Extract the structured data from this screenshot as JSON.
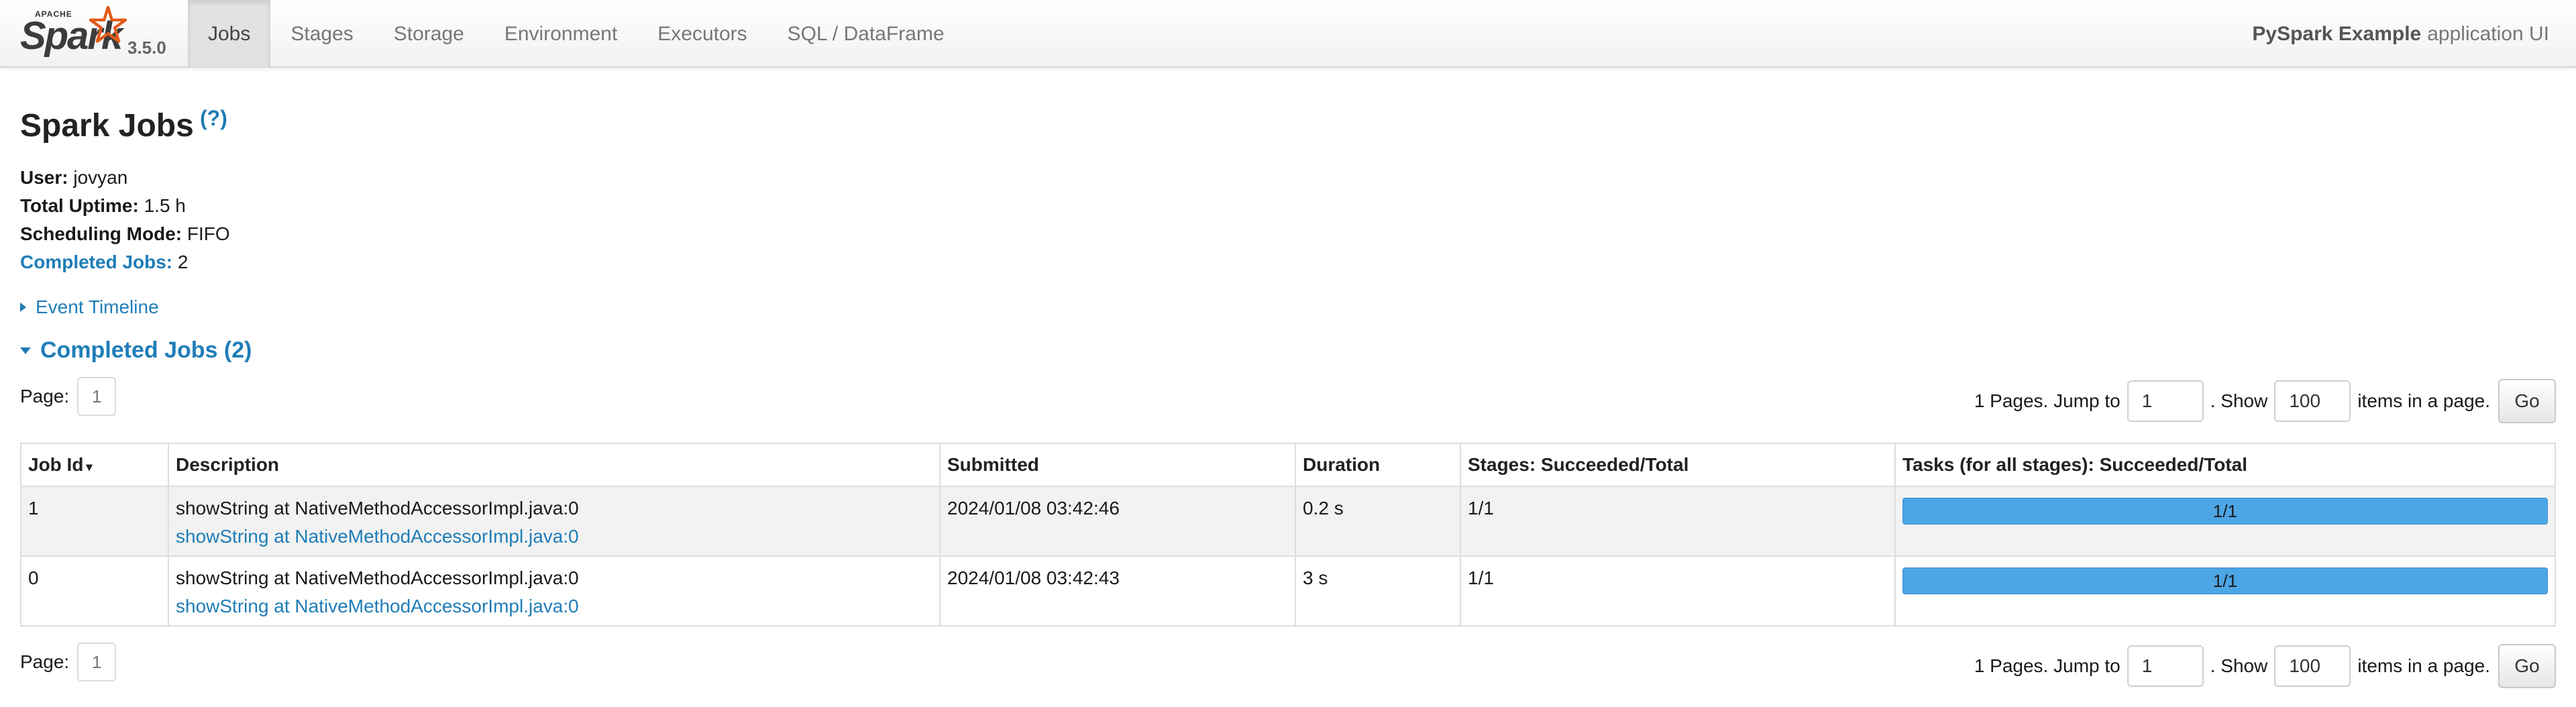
{
  "brand": {
    "apache": "APACHE",
    "name": "Spark",
    "version": "3.5.0"
  },
  "nav": {
    "items": [
      "Jobs",
      "Stages",
      "Storage",
      "Environment",
      "Executors",
      "SQL / DataFrame"
    ],
    "active": "Jobs"
  },
  "app": {
    "name": "PySpark Example",
    "suffix": "application UI"
  },
  "page": {
    "title": "Spark Jobs",
    "help": "(?)"
  },
  "summary": {
    "user_label": "User:",
    "user": "jovyan",
    "uptime_label": "Total Uptime:",
    "uptime": "1.5 h",
    "mode_label": "Scheduling Mode:",
    "mode": "FIFO",
    "completed_label": "Completed Jobs:",
    "completed": "2"
  },
  "timeline_label": "Event Timeline",
  "section_title": "Completed Jobs (2)",
  "pager": {
    "page_label": "Page:",
    "page": "1",
    "pages_text": "1 Pages. Jump to",
    "jump_value": "1",
    "show_text": ". Show",
    "show_value": "100",
    "items_text": "items in a page.",
    "go": "Go"
  },
  "table": {
    "headers": [
      "Job Id",
      "Description",
      "Submitted",
      "Duration",
      "Stages: Succeeded/Total",
      "Tasks (for all stages): Succeeded/Total"
    ],
    "sort_indicator": "▾",
    "rows": [
      {
        "id": "1",
        "desc": "showString at NativeMethodAccessorImpl.java:0",
        "desc_link": "showString at NativeMethodAccessorImpl.java:0",
        "submitted": "2024/01/08 03:42:46",
        "duration": "0.2 s",
        "stages": "1/1",
        "tasks": "1/1",
        "task_progress": 1.0
      },
      {
        "id": "0",
        "desc": "showString at NativeMethodAccessorImpl.java:0",
        "desc_link": "showString at NativeMethodAccessorImpl.java:0",
        "submitted": "2024/01/08 03:42:43",
        "duration": "3 s",
        "stages": "1/1",
        "tasks": "1/1",
        "task_progress": 1.0
      }
    ]
  },
  "colors": {
    "link": "#1f7db8",
    "progress": "#4ca5e5",
    "logo_star": "#e25a1c"
  }
}
